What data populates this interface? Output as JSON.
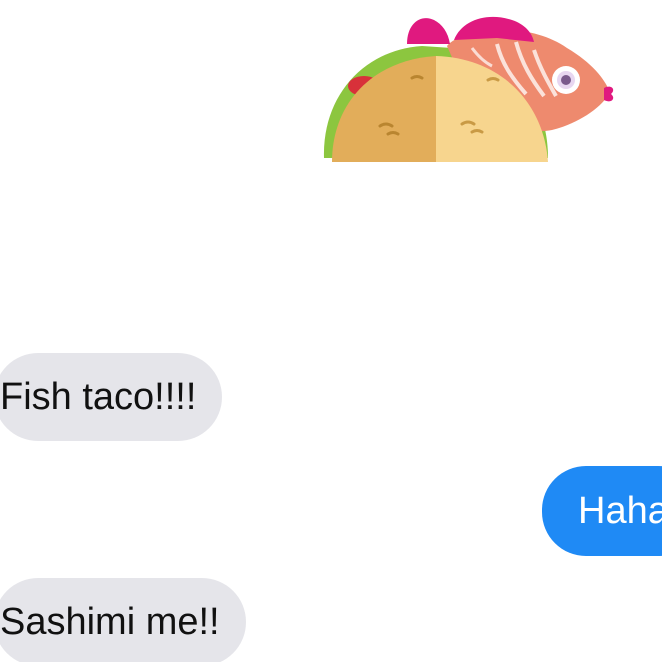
{
  "colors": {
    "incoming_bubble": "#e5e5ea",
    "outgoing_bubble": "#1f8af5",
    "incoming_text": "#111111",
    "outgoing_text": "#ffffff",
    "background": "#ffffff"
  },
  "sticker": {
    "icon": "fish-taco-sticker"
  },
  "messages": [
    {
      "direction": "incoming",
      "text": "Fish taco!!!!"
    },
    {
      "direction": "outgoing",
      "text": "Haha"
    },
    {
      "direction": "incoming",
      "text": "Sashimi me!!"
    }
  ]
}
